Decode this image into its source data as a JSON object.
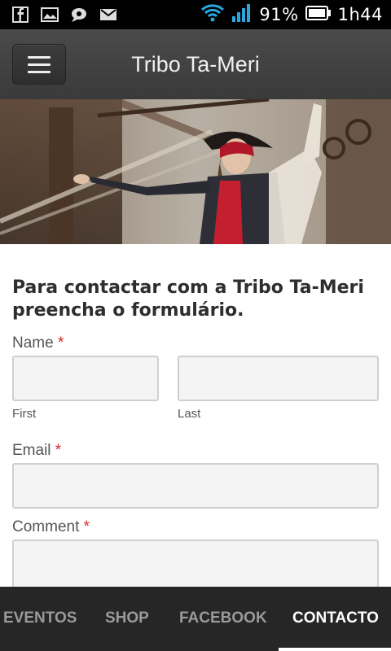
{
  "status": {
    "icons": [
      "facebook-icon",
      "gallery-icon",
      "chat-icon",
      "mail-icon",
      "wifi-icon",
      "signal-icon",
      "battery-icon"
    ],
    "battery": "91%",
    "time": "1h44"
  },
  "header": {
    "title": "Tribo Ta-Meri"
  },
  "form": {
    "heading": "Para contactar com a Tribo Ta-Meri preencha o formulário.",
    "required_marker": "*",
    "name_label": "Name",
    "first_sublabel": "First",
    "last_sublabel": "Last",
    "email_label": "Email",
    "comment_label": "Comment",
    "first_value": "",
    "last_value": "",
    "email_value": ""
  },
  "nav": {
    "items": [
      "EVENTOS",
      "SHOP",
      "FACEBOOK",
      "CONTACTO"
    ],
    "active": "CONTACTO"
  },
  "colors": {
    "appbar": "#404040",
    "nav_bg": "#262626",
    "required": "#d9262c",
    "heading": "#2e2e2e"
  }
}
